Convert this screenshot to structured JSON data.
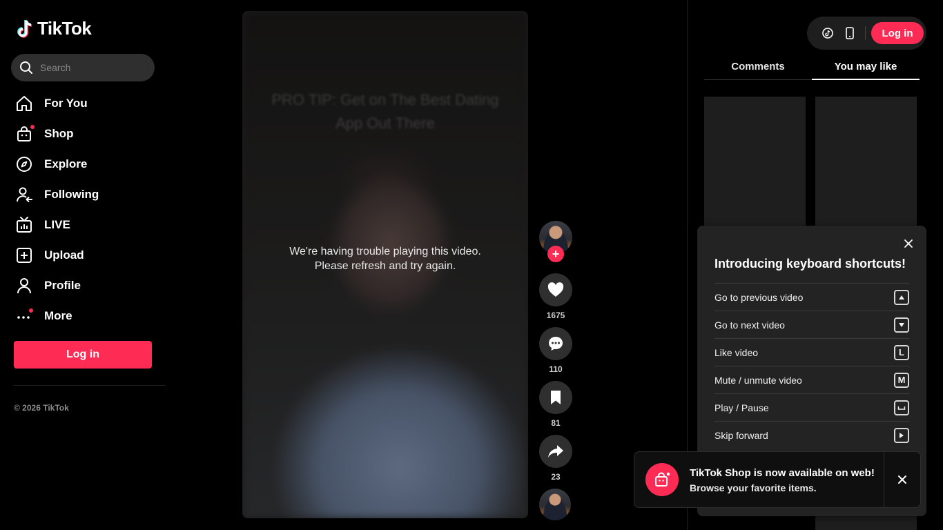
{
  "brand": {
    "name": "TikTok",
    "accent_color": "#fe2c55"
  },
  "search": {
    "placeholder": "Search"
  },
  "sidebar": {
    "items": [
      {
        "label": "For You",
        "icon": "home-icon"
      },
      {
        "label": "Shop",
        "icon": "shopping-bag-icon",
        "badge_dot": true
      },
      {
        "label": "Explore",
        "icon": "compass-icon"
      },
      {
        "label": "Following",
        "icon": "following-user-icon"
      },
      {
        "label": "LIVE",
        "icon": "live-tv-icon"
      },
      {
        "label": "Upload",
        "icon": "upload-plus-icon"
      },
      {
        "label": "Profile",
        "icon": "profile-user-icon"
      },
      {
        "label": "More",
        "icon": "more-dots-icon",
        "badge_dot": true
      }
    ],
    "login_label": "Log in",
    "copyright": "© 2026 TikTok"
  },
  "video": {
    "caption_overlay": "PRO TIP: Get on The Best Dating App Out There",
    "error_line1": "We're having trouble playing this video.",
    "error_line2": "Please refresh and try again."
  },
  "actions": {
    "like_count": "1675",
    "comment_count": "110",
    "bookmark_count": "81",
    "share_count": "23",
    "follow_label": "+"
  },
  "header": {
    "login_label": "Log in"
  },
  "tabs": [
    {
      "label": "Comments",
      "active": false
    },
    {
      "label": "You may like",
      "active": true
    }
  ],
  "shortcuts": {
    "title": "Introducing keyboard shortcuts!",
    "items": [
      {
        "label": "Go to previous video",
        "key": "up-arrow-key-icon"
      },
      {
        "label": "Go to next video",
        "key": "down-arrow-key-icon"
      },
      {
        "label": "Like video",
        "key": "L"
      },
      {
        "label": "Mute / unmute video",
        "key": "M"
      },
      {
        "label": "Play / Pause",
        "key": "space-key-icon"
      },
      {
        "label": "Skip forward",
        "key": "right-arrow-key-icon"
      }
    ]
  },
  "toast": {
    "title": "TikTok Shop is now available on web!",
    "subtitle": "Browse your favorite items."
  }
}
